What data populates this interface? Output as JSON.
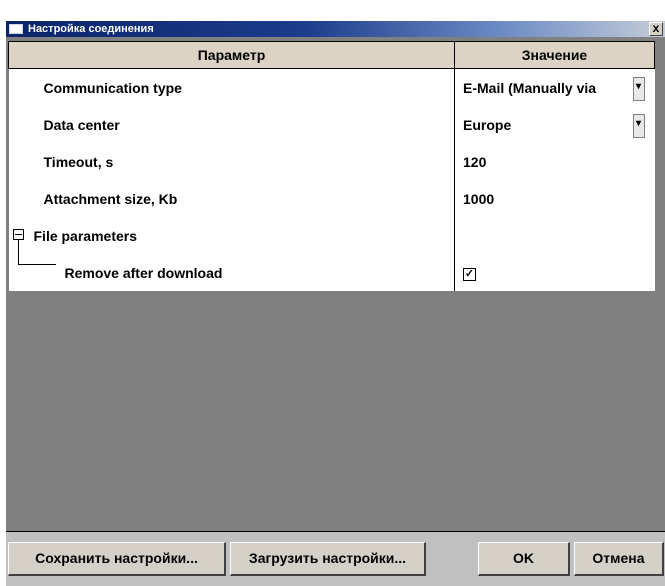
{
  "window": {
    "title": "Настройка соединения",
    "close_label": "x"
  },
  "grid": {
    "headers": {
      "param": "Параметр",
      "value": "Значение"
    },
    "rows": [
      {
        "label": "Communication type",
        "value": "E-Mail (Manually via"
      },
      {
        "label": "Data center",
        "value": "Europe"
      },
      {
        "label": "Timeout, s",
        "value": "120"
      },
      {
        "label": "Attachment size, Kb",
        "value": "1000"
      },
      {
        "label": "File parameters",
        "value": ""
      },
      {
        "label": "Remove after download",
        "value": "checked"
      }
    ]
  },
  "buttons": {
    "save": "Сохранить настройки...",
    "load": "Загрузить настройки...",
    "ok": "OK",
    "cancel": "Отмена"
  },
  "colors": {
    "titlebar": "#0a246a",
    "header_bg": "#dcd3c4",
    "workspace": "#808080",
    "dialog_bg": "#c0c0c0"
  }
}
